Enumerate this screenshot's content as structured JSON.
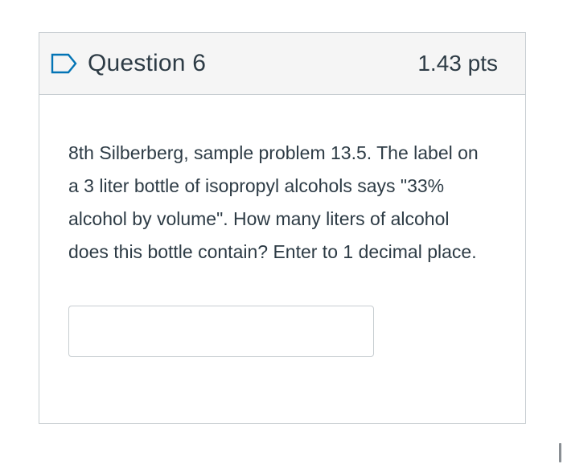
{
  "question": {
    "title": "Question 6",
    "points": "1.43 pts",
    "flag_icon": "bookmark-flag-icon",
    "text": "8th Silberberg, sample problem 13.5.  The label on a 3 liter bottle of isopropyl alcohols says \"33% alcohol by volume\".  How many liters of alcohol does this bottle contain?  Enter to 1 decimal place.",
    "answer": {
      "value": "",
      "placeholder": ""
    }
  },
  "colors": {
    "header_bg": "#f5f5f5",
    "border": "#c7cdd1",
    "flag": "#0374b5",
    "text": "#2d3b45"
  }
}
